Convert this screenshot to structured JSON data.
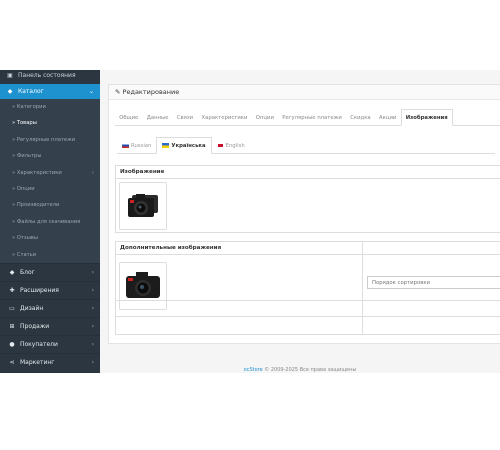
{
  "sidebar": {
    "dashboard": "Панель состояния",
    "catalog": "Каталог",
    "catalog_sub": [
      {
        "label": "Категории",
        "active": false,
        "chevron": false
      },
      {
        "label": "Товары",
        "active": true,
        "chevron": false
      },
      {
        "label": "Регулярные платежи",
        "active": false,
        "chevron": false
      },
      {
        "label": "Фильтры",
        "active": false,
        "chevron": false
      },
      {
        "label": "Характеристики",
        "active": false,
        "chevron": true
      },
      {
        "label": "Опции",
        "active": false,
        "chevron": false
      },
      {
        "label": "Производители",
        "active": false,
        "chevron": false
      },
      {
        "label": "Файлы для скачивания",
        "active": false,
        "chevron": false
      },
      {
        "label": "Отзывы",
        "active": false,
        "chevron": false
      },
      {
        "label": "Статьи",
        "active": false,
        "chevron": false
      }
    ],
    "main": [
      {
        "label": "Блог",
        "icon": "tag-icon"
      },
      {
        "label": "Расширения",
        "icon": "puzzle-icon"
      },
      {
        "label": "Дизайн",
        "icon": "monitor-icon"
      },
      {
        "label": "Продажи",
        "icon": "cart-icon"
      },
      {
        "label": "Покупатели",
        "icon": "user-icon"
      },
      {
        "label": "Маркетинг",
        "icon": "share-icon"
      }
    ]
  },
  "panel": {
    "title": "Редактирование",
    "tabs": [
      "Общие",
      "Данные",
      "Связи",
      "Характеристики",
      "Опции",
      "Регулярные платежи",
      "Скидка",
      "Акции",
      "Изображения"
    ],
    "active_tab": 8,
    "lang_tabs": [
      {
        "label": "Russian",
        "flag": "ru"
      },
      {
        "label": "Українська",
        "flag": "ua"
      },
      {
        "label": "English",
        "flag": "gb"
      }
    ],
    "active_lang": 1
  },
  "images": {
    "image_header": "Изображение",
    "additional_header": "Дополнительные изображения",
    "sort_placeholder": "Порядок сортировки"
  },
  "footer": {
    "link": "ocStore",
    "text": "© 2009-2025 Все права защищены"
  },
  "colors": {
    "sidebar_bg": "#2b3640",
    "accent": "#1e91cf"
  }
}
